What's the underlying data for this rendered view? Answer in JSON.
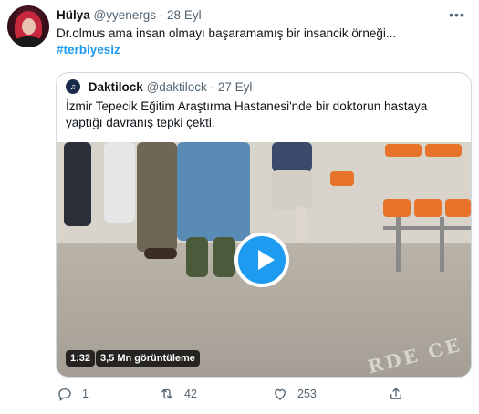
{
  "tweet": {
    "author_name": "Hülya",
    "author_handle": "@yyenergs",
    "separator": "·",
    "date": "28 Eyl",
    "text": "Dr.olmus ama insan olmayı başaramamış bir insancik örneği...",
    "hashtag": "#terbiyesiz",
    "more_icon": "more-dots-icon"
  },
  "quote": {
    "author_name": "Daktilock",
    "author_handle": "@daktilock",
    "separator": "·",
    "date": "27 Eyl",
    "text": "İzmir Tepecik Eğitim Araştırma Hastanesi'nde bir doktorun hastaya yaptığı davranış tepki çekti.",
    "media": {
      "duration": "1:32",
      "views": "3,5 Mn görüntüleme",
      "watermark": "RDE CE"
    }
  },
  "actions": {
    "reply_count": "1",
    "retweet_count": "42",
    "like_count": "253",
    "share_label": ""
  },
  "colors": {
    "accent": "#1d9bf0",
    "text": "#0f1419",
    "muted": "#536471",
    "border": "#cfd9de"
  }
}
